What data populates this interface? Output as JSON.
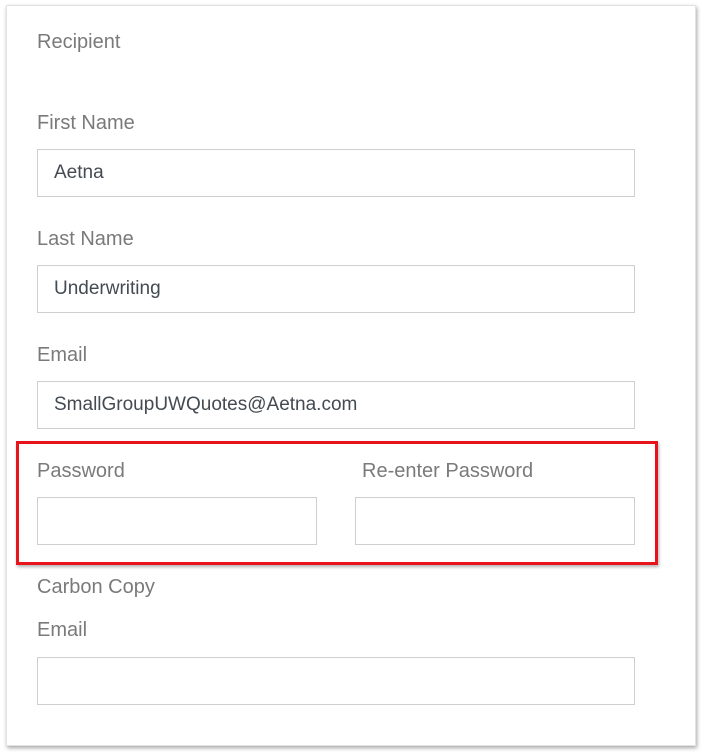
{
  "recipient": {
    "section_title": "Recipient",
    "first_name": {
      "label": "First Name",
      "value": "Aetna"
    },
    "last_name": {
      "label": "Last Name",
      "value": "Underwriting"
    },
    "email": {
      "label": "Email",
      "value": "SmallGroupUWQuotes@Aetna.com"
    },
    "password": {
      "label": "Password",
      "value": ""
    },
    "reenter_password": {
      "label": "Re-enter Password",
      "value": ""
    }
  },
  "carbon_copy": {
    "section_title": "Carbon Copy",
    "email": {
      "label": "Email",
      "value": ""
    }
  },
  "colors": {
    "highlight_border": "#e8141b",
    "label_text": "#7a7a7a",
    "input_text": "#444a52",
    "input_border": "#cfcfcf"
  }
}
